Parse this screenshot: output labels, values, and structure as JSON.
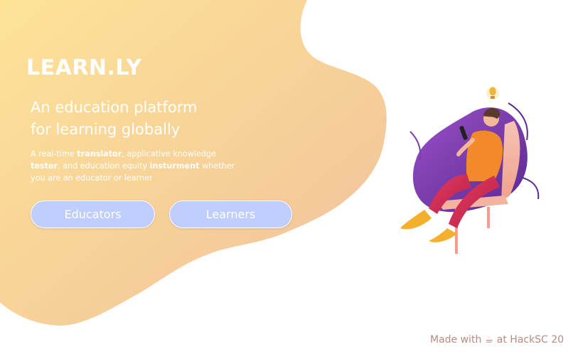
{
  "brand": {
    "logo": "LEARN.LY"
  },
  "hero": {
    "tagline_line1": "An education platform",
    "tagline_line2": "for learning globally",
    "description": {
      "part1": "A real-time ",
      "bold1": "translator",
      "part2": ", applicative knowledge ",
      "bold2": "tester",
      "part3": ", and education equity ",
      "bold3": "insturment",
      "part4": " whether you are an educator or learner"
    }
  },
  "buttons": {
    "educators": "Educators",
    "learners": "Learners"
  },
  "footer": {
    "prefix": "Made with",
    "icon": "coffee-icon",
    "glyph": "☕",
    "suffix": "at HackSC 20"
  },
  "colors": {
    "blob_start": "#fbe196",
    "blob_end": "#f2c09e",
    "button_bg": "#bfcdff",
    "footer_text": "#b88a83",
    "accent_purple": "#7b3fae",
    "accent_orange": "#f28a2c"
  }
}
